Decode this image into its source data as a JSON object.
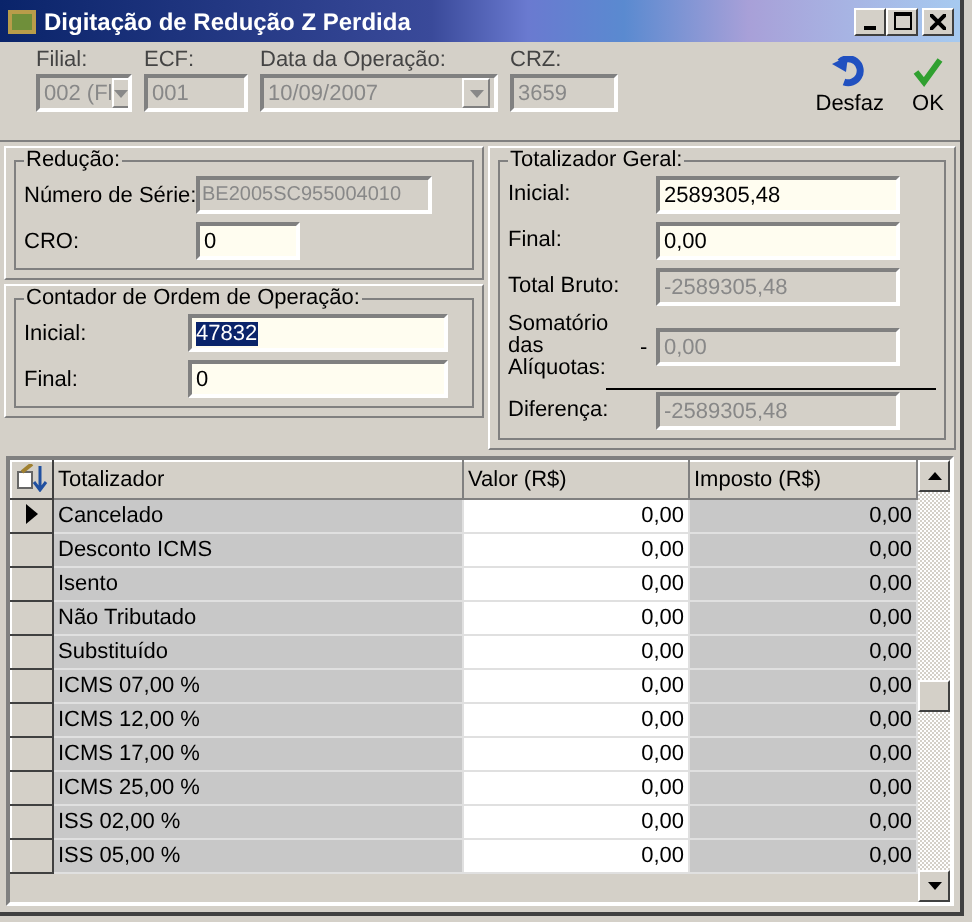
{
  "window": {
    "title": "Digitação de Redução Z Perdida"
  },
  "toolbar": {
    "fields": [
      {
        "label": "Filial:",
        "value": "002 (Fl",
        "kind": "combo",
        "disabled": true
      },
      {
        "label": "ECF:",
        "value": "001",
        "kind": "text",
        "disabled": true
      },
      {
        "label": "Data da Operação:",
        "value": "10/09/2007",
        "kind": "combo",
        "disabled": true
      },
      {
        "label": "CRZ:",
        "value": "3659",
        "kind": "text",
        "disabled": true
      }
    ],
    "buttons": [
      {
        "label": "Desfaz",
        "kind": "undo"
      },
      {
        "label": "OK",
        "kind": "ok"
      }
    ]
  },
  "reducao": {
    "title": "Redução:",
    "fields": [
      {
        "label": "Número de Série:",
        "value": "BE2005SC955004010",
        "disabled": true,
        "selected": false
      },
      {
        "label": "CRO:",
        "value": "0",
        "disabled": false,
        "selected": false
      }
    ]
  },
  "contador": {
    "title": "Contador de Ordem de Operação:",
    "fields": [
      {
        "label": "Inicial:",
        "value": "47832",
        "disabled": false,
        "selected": true
      },
      {
        "label": "Final:",
        "value": "0",
        "disabled": false,
        "selected": false
      }
    ]
  },
  "totalizador_geral": {
    "title": "Totalizador Geral:",
    "fields": [
      {
        "label": "Inicial:",
        "value": "2589305,48",
        "disabled": false,
        "selected": false
      },
      {
        "label": "Final:",
        "value": "0,00",
        "disabled": false,
        "selected": false
      },
      {
        "label": "Total Bruto:",
        "value": "-2589305,48",
        "disabled": true,
        "selected": false
      },
      {
        "label": "Somatório das Alíquotas:",
        "value": "0,00",
        "disabled": true,
        "selected": false,
        "sign": "-"
      },
      {
        "label": "Diferença:",
        "value": "-2589305,48",
        "disabled": true,
        "selected": false
      }
    ]
  },
  "table": {
    "columns": [
      "Totalizador",
      "Valor (R$)",
      "Imposto (R$)"
    ],
    "rows": [
      {
        "cells": [
          "Cancelado",
          "0,00",
          "0,00"
        ],
        "current": true
      },
      {
        "cells": [
          "Desconto ICMS",
          "0,00",
          "0,00"
        ],
        "current": false
      },
      {
        "cells": [
          "Isento",
          "0,00",
          "0,00"
        ],
        "current": false
      },
      {
        "cells": [
          "Não Tributado",
          "0,00",
          "0,00"
        ],
        "current": false
      },
      {
        "cells": [
          "Substituído",
          "0,00",
          "0,00"
        ],
        "current": false
      },
      {
        "cells": [
          "ICMS 07,00 %",
          "0,00",
          "0,00"
        ],
        "current": false
      },
      {
        "cells": [
          "ICMS 12,00 %",
          "0,00",
          "0,00"
        ],
        "current": false
      },
      {
        "cells": [
          "ICMS 17,00 %",
          "0,00",
          "0,00"
        ],
        "current": false
      },
      {
        "cells": [
          "ICMS 25,00 %",
          "0,00",
          "0,00"
        ],
        "current": false
      },
      {
        "cells": [
          "ISS 02,00 %",
          "0,00",
          "0,00"
        ],
        "current": false
      },
      {
        "cells": [
          "ISS 05,00 %",
          "0,00",
          "0,00"
        ],
        "current": false
      }
    ]
  }
}
